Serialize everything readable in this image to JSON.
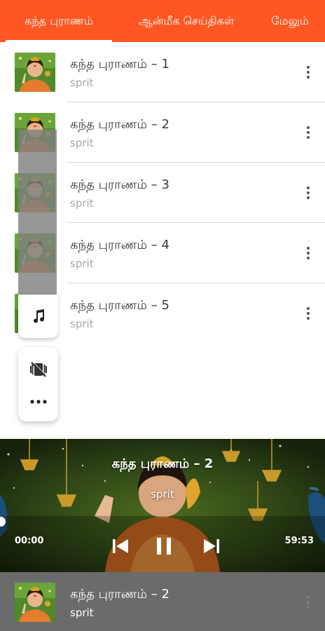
{
  "tabs": [
    {
      "label": "கந்த புராணம்",
      "active": true
    },
    {
      "label": "ஆன்மீக செய்திகள்"
    },
    {
      "label": "மேலும்"
    }
  ],
  "tracks": [
    {
      "title": "கந்த புராணம் – 1",
      "subtitle": "sprit"
    },
    {
      "title": "கந்த புராணம் – 2",
      "subtitle": "sprit"
    },
    {
      "title": "கந்த புராணம் – 3",
      "subtitle": "sprit"
    },
    {
      "title": "கந்த புராணம் – 4",
      "subtitle": "sprit"
    },
    {
      "title": "கந்த புராணம் – 5",
      "subtitle": "sprit"
    }
  ],
  "side_panel": {
    "icons": [
      "music-note-icon",
      "mute-vibrate-icon",
      "more-horizontal-icon"
    ]
  },
  "player": {
    "title": "கந்த புராணம் – 2",
    "subtitle": "sprit",
    "elapsed": "00:00",
    "duration": "59:53",
    "progress": 0,
    "state": "playing"
  },
  "mini_player": {
    "title": "கந்த புராணம் – 2",
    "subtitle": "sprit"
  },
  "colors": {
    "accent": "#ff5722",
    "mini_bar": "#6b6b6b",
    "divider": "#d8d8d8"
  }
}
